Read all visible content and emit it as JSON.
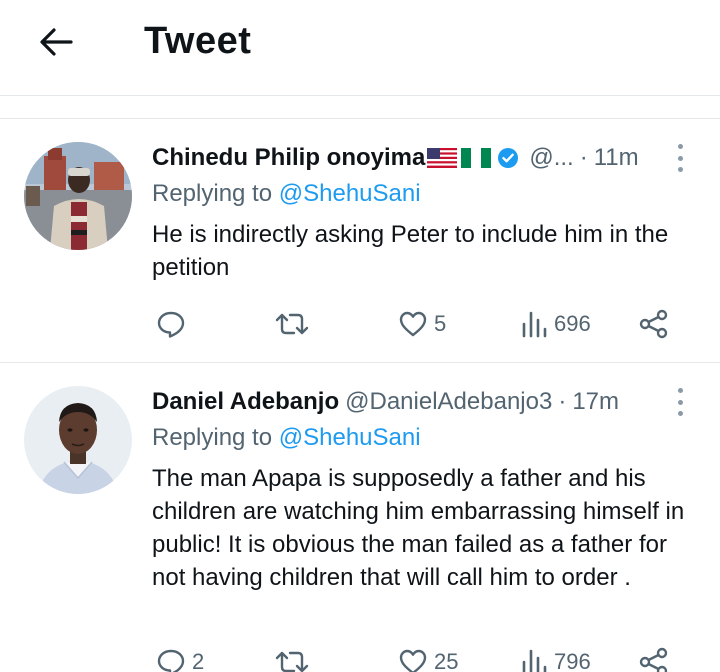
{
  "header": {
    "title": "Tweet",
    "back_icon": "arrow-left-icon"
  },
  "tweets": [
    {
      "name": "Chinedu Philip onoyima",
      "flags": [
        "us-flag",
        "nigeria-flag"
      ],
      "verified": true,
      "handle": "@...",
      "separator": "·",
      "time": "11m",
      "replying_prefix": "Replying to ",
      "replying_to": "@ShehuSani",
      "text": "He is indirectly asking Peter to include him in the petition",
      "reply_count": "",
      "retweet_count": "",
      "like_count": "5",
      "view_count": "696"
    },
    {
      "name": "Daniel Adebanjo",
      "handle": "@DanielAdebanjo3",
      "separator": "·",
      "time": "17m",
      "replying_prefix": "Replying to ",
      "replying_to": "@ShehuSani",
      "text": "The man Apapa is supposedly a father and his children are watching him embarrassing himself in public! It is obvious the man failed as a father for not having children that will call him to order .",
      "reply_count": "2",
      "retweet_count": "",
      "like_count": "25",
      "view_count": "796"
    }
  ],
  "colors": {
    "accent": "#1d9bf0",
    "secondary_text": "#536471",
    "divider": "#e6e9ec"
  }
}
